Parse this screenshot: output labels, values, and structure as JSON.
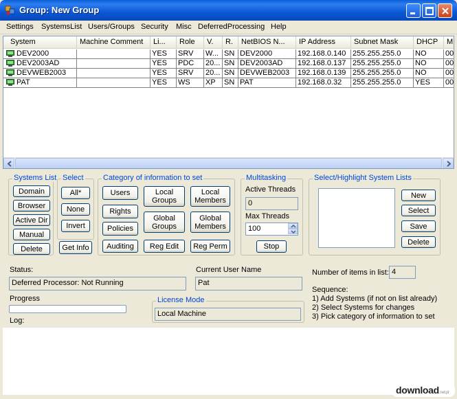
{
  "window": {
    "title": "Group: New Group"
  },
  "menu": [
    "Settings",
    "SystemsList",
    "Users/Groups",
    "Security",
    "Misc",
    "DeferredProcessing",
    "Help"
  ],
  "list": {
    "columns": [
      "System",
      "Machine Comment",
      "Li...",
      "Role",
      "V.",
      "R.",
      "NetBIOS N...",
      "IP Address",
      "Subnet Mask",
      "DHCP",
      "M"
    ],
    "rows": [
      [
        "DEV2000",
        "",
        "YES",
        "SRV",
        "W...",
        "SN",
        "DEV2000",
        "192.168.0.140",
        "255.255.255.0",
        "NO",
        "00"
      ],
      [
        "DEV2003AD",
        "",
        "YES",
        "PDC",
        "20...",
        "SN",
        "DEV2003AD",
        "192.168.0.137",
        "255.255.255.0",
        "NO",
        "00"
      ],
      [
        "DEVWEB2003",
        "",
        "YES",
        "SRV",
        "20...",
        "SN",
        "DEVWEB2003",
        "192.168.0.139",
        "255.255.255.0",
        "NO",
        "00"
      ],
      [
        "PAT",
        "",
        "YES",
        "WS",
        "XP",
        "SN",
        "PAT",
        "192.168.0.32",
        "255.255.255.0",
        "YES",
        "00"
      ]
    ]
  },
  "systems_list": {
    "title": "Systems List",
    "buttons": [
      "Domain",
      "Browser",
      "Active Dir",
      "Manual",
      "Delete"
    ]
  },
  "select": {
    "title": "Select",
    "buttons": [
      "All*",
      "None",
      "Invert"
    ],
    "get_info": "Get Info"
  },
  "category": {
    "title": "Category of information to set",
    "users": "Users",
    "local_groups": "Local Groups",
    "local_members": "Local Members",
    "rights": "Rights",
    "policies": "Policies",
    "global_groups": "Global Groups",
    "global_members": "Global Members",
    "auditing": "Auditing",
    "reg_edit": "Reg Edit",
    "reg_perm": "Reg Perm"
  },
  "multitasking": {
    "title": "Multitasking",
    "active_threads_label": "Active Threads",
    "active_threads": "0",
    "max_threads_label": "Max Threads",
    "max_threads": "100",
    "stop": "Stop"
  },
  "highlight": {
    "title": "Select/Highlight System Lists",
    "buttons": [
      "New",
      "Select",
      "Save",
      "Delete"
    ]
  },
  "status": {
    "label": "Status:",
    "value": "Deferred Processor: Not Running"
  },
  "current_user": {
    "label": "Current User Name",
    "value": "Pat"
  },
  "items_count": {
    "label": "Number of items in list:",
    "value": "4"
  },
  "progress": {
    "label": "Progress",
    "fraction": 0
  },
  "log": {
    "label": "Log:"
  },
  "license": {
    "title": "License Mode",
    "value": "Local Machine"
  },
  "sequence": {
    "title": "Sequence:",
    "steps": [
      "1) Add Systems (if not on list already)",
      "2) Select Systems for changes",
      "3) Pick category of information to set"
    ]
  },
  "watermark": {
    "text": "download",
    "suffix": ".net.pl"
  }
}
